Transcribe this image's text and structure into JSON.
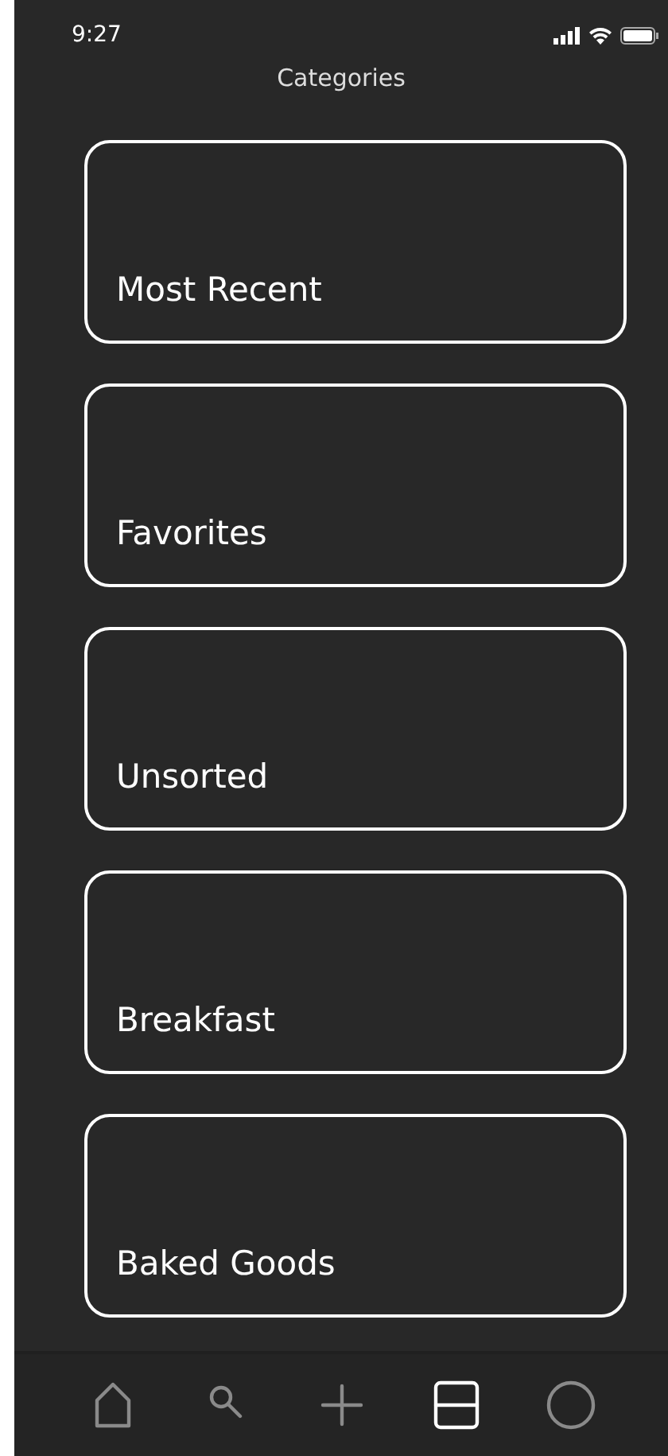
{
  "status_bar": {
    "time": "9:27"
  },
  "title": "Categories",
  "categories": [
    {
      "label": "Most Recent"
    },
    {
      "label": "Favorites"
    },
    {
      "label": "Unsorted"
    },
    {
      "label": "Breakfast"
    },
    {
      "label": "Baked Goods"
    }
  ],
  "nav": [
    {
      "kind": "home",
      "selected": false
    },
    {
      "kind": "search",
      "selected": false
    },
    {
      "kind": "add",
      "selected": false
    },
    {
      "kind": "categories",
      "selected": true
    },
    {
      "kind": "profile",
      "selected": false
    }
  ]
}
